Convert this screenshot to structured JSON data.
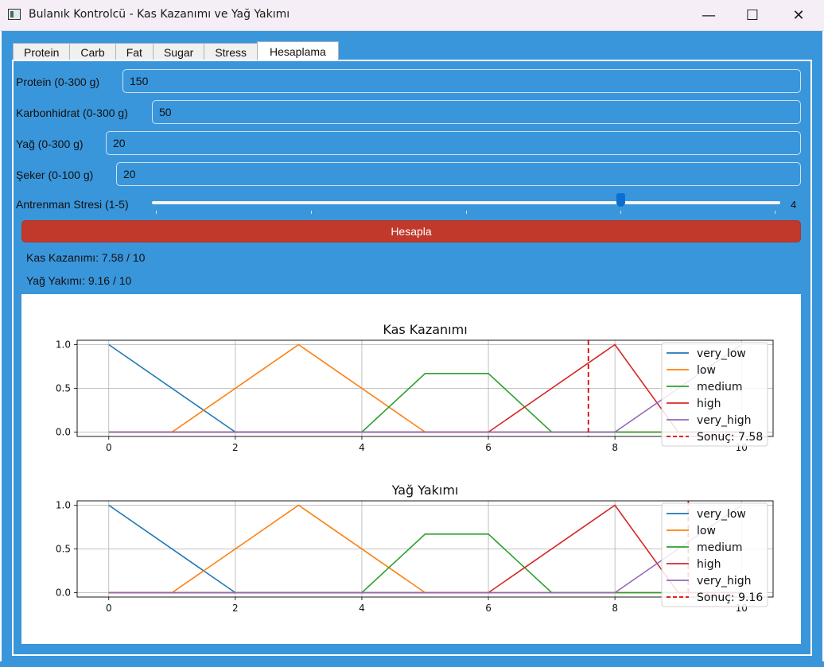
{
  "window": {
    "title": "Bulanık Kontrolcü - Kas Kazanımı ve Yağ Yakımı",
    "minimize_glyph": "—",
    "maximize_glyph": "☐",
    "close_glyph": "✕"
  },
  "tabs": [
    {
      "label": "Protein"
    },
    {
      "label": "Carb"
    },
    {
      "label": "Fat"
    },
    {
      "label": "Sugar"
    },
    {
      "label": "Stress"
    },
    {
      "label": "Hesaplama",
      "active": true
    }
  ],
  "form": {
    "protein": {
      "label": "Protein (0-300 g)",
      "value": "150"
    },
    "carb": {
      "label": "Karbonhidrat (0-300 g)",
      "value": "50"
    },
    "fat": {
      "label": "Yağ (0-300 g)",
      "value": "20"
    },
    "sugar": {
      "label": "Şeker (0-100 g)",
      "value": "20"
    },
    "stress": {
      "label": "Antrenman Stresi (1-5)",
      "value": "4",
      "min": 1,
      "max": 5,
      "level": 4
    }
  },
  "button": {
    "label": "Hesapla"
  },
  "results": {
    "muscle": "Kas Kazanımı: 7.58 / 10",
    "fat_burn": "Yağ Yakımı: 9.16 / 10"
  },
  "colors": {
    "window_bg": "#3a96db",
    "button_bg": "#c0392b",
    "very_low": "#1f77b4",
    "low": "#ff7f0e",
    "medium": "#2ca02c",
    "high": "#d62728",
    "very_high": "#9467bd",
    "result_line": "#e00000"
  },
  "chart_data": [
    {
      "type": "line",
      "title": "Kas Kazanımı",
      "xlim": [
        -0.5,
        10.5
      ],
      "ylim": [
        -0.05,
        1.05
      ],
      "xticks": [
        "0",
        "2",
        "4",
        "6",
        "8",
        "10"
      ],
      "yticks": [
        "0.0",
        "0.5",
        "1.0"
      ],
      "grid": true,
      "legend_placement": "right",
      "series": [
        {
          "name": "very_low",
          "x": [
            0,
            2,
            10
          ],
          "y": [
            1,
            0,
            0
          ]
        },
        {
          "name": "low",
          "x": [
            0,
            1,
            3,
            5,
            10
          ],
          "y": [
            0,
            0,
            1,
            0,
            0
          ]
        },
        {
          "name": "medium",
          "x": [
            0,
            4,
            5,
            6,
            7,
            10
          ],
          "y": [
            0,
            0,
            0.67,
            0.67,
            0,
            0
          ]
        },
        {
          "name": "high",
          "x": [
            0,
            6,
            8,
            9,
            10
          ],
          "y": [
            0,
            0,
            1,
            0,
            0
          ]
        },
        {
          "name": "very_high",
          "x": [
            0,
            8,
            10
          ],
          "y": [
            0,
            0,
            1
          ]
        }
      ],
      "result": {
        "name": "Sonuç: 7.58",
        "x": 7.58
      }
    },
    {
      "type": "line",
      "title": "Yağ Yakımı",
      "xlim": [
        -0.5,
        10.5
      ],
      "ylim": [
        -0.05,
        1.05
      ],
      "xticks": [
        "0",
        "2",
        "4",
        "6",
        "8",
        "10"
      ],
      "yticks": [
        "0.0",
        "0.5",
        "1.0"
      ],
      "grid": true,
      "legend_placement": "right",
      "series": [
        {
          "name": "very_low",
          "x": [
            0,
            2,
            10
          ],
          "y": [
            1,
            0,
            0
          ]
        },
        {
          "name": "low",
          "x": [
            0,
            1,
            3,
            5,
            10
          ],
          "y": [
            0,
            0,
            1,
            0,
            0
          ]
        },
        {
          "name": "medium",
          "x": [
            0,
            4,
            5,
            6,
            7,
            10
          ],
          "y": [
            0,
            0,
            0.67,
            0.67,
            0,
            0
          ]
        },
        {
          "name": "high",
          "x": [
            0,
            6,
            8,
            9,
            10
          ],
          "y": [
            0,
            0,
            1,
            0,
            0
          ]
        },
        {
          "name": "very_high",
          "x": [
            0,
            8,
            10
          ],
          "y": [
            0,
            0,
            1
          ]
        }
      ],
      "result": {
        "name": "Sonuç: 9.16",
        "x": 9.16
      }
    }
  ]
}
